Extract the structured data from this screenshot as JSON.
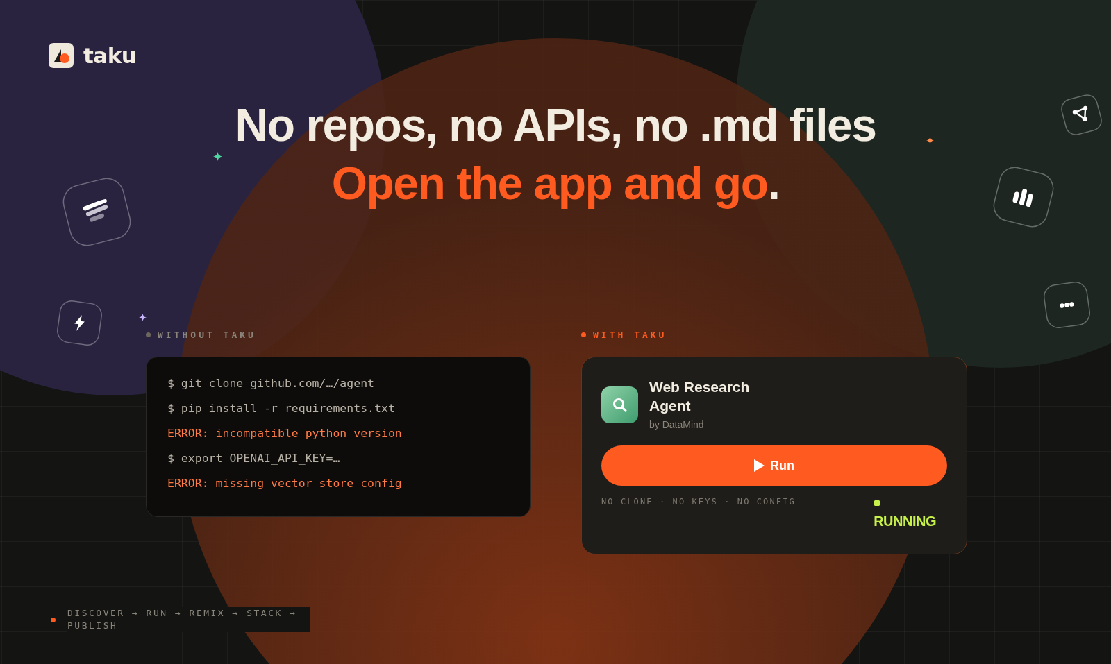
{
  "brand": {
    "name": "taku"
  },
  "headline": {
    "line_1": "No repos, no APIs, no .md files",
    "line_2": "Open the app and go",
    "line_2_end": "."
  },
  "without": {
    "label": "WITHOUT TAKU",
    "lines": [
      {
        "kind": "command",
        "text": "$ git clone github.com/…/agent"
      },
      {
        "kind": "command",
        "text": "$ pip install -r requirements.txt"
      },
      {
        "kind": "error",
        "text": "ERROR: incompatible python version"
      },
      {
        "kind": "command",
        "text": "$ export OPENAI_API_KEY=…"
      },
      {
        "kind": "error",
        "text": "ERROR: missing vector store config"
      }
    ]
  },
  "with": {
    "label": "WITH TAKU",
    "agent": {
      "name": "Web Research Agent",
      "author": "by DataMind"
    },
    "run_button": "Run",
    "features": "NO CLONE · NO KEYS · NO CONFIG",
    "status": "RUNNING"
  },
  "steps": "DISCOVER → RUN → REMIX → STACK → PUBLISH"
}
